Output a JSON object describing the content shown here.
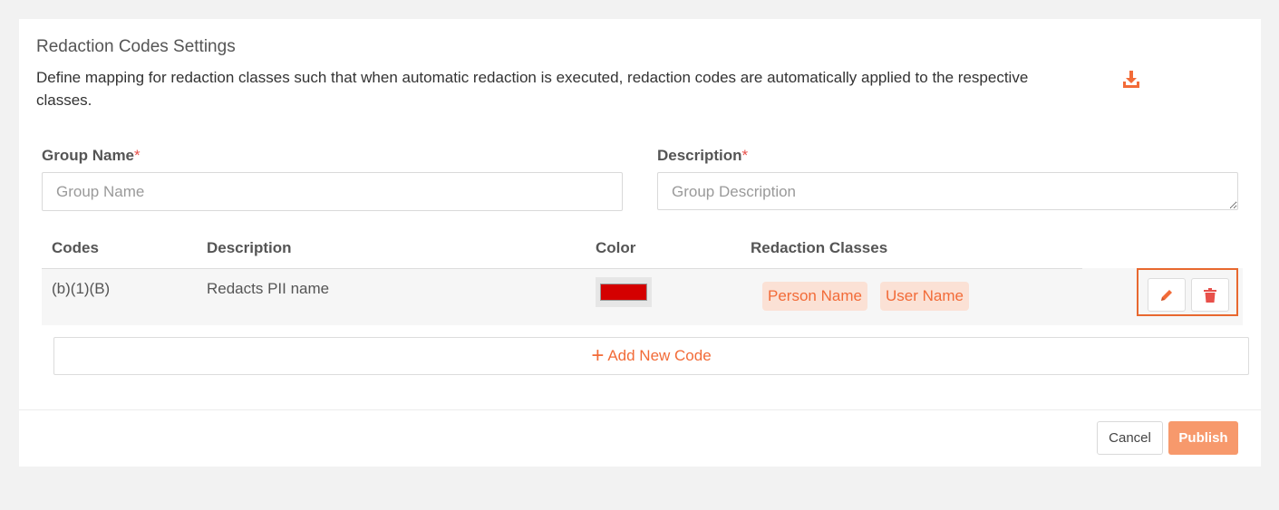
{
  "header": {
    "title": "Redaction Codes Settings",
    "subtitle": "Define mapping for redaction classes such that when automatic redaction is executed, redaction codes are automatically applied to the respective classes.",
    "download_icon": "download-icon"
  },
  "form": {
    "group_name": {
      "label": "Group Name",
      "required_mark": "*",
      "placeholder": "Group Name",
      "value": ""
    },
    "description": {
      "label": "Description",
      "required_mark": "*",
      "placeholder": "Group Description",
      "value": ""
    }
  },
  "table": {
    "columns": [
      "Codes",
      "Description",
      "Color",
      "Redaction Classes"
    ],
    "rows": [
      {
        "code": "(b)(1)(B)",
        "description": "Redacts PII name",
        "color": "#d40000",
        "classes": [
          "Person Name",
          "User Name"
        ],
        "actions": {
          "edit_icon": "pencil-icon",
          "delete_icon": "trash-icon"
        }
      }
    ]
  },
  "add_code": {
    "plus": "+",
    "label": "Add New Code"
  },
  "footer": {
    "cancel_label": "Cancel",
    "publish_label": "Publish"
  },
  "colors": {
    "accent": "#f26b38",
    "publish_bg": "#f7996c",
    "tag_bg": "#fbe1d5",
    "highlight_border": "#e8682f"
  }
}
